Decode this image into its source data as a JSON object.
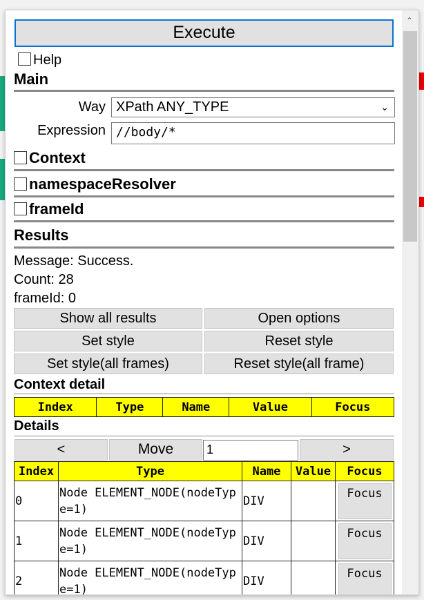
{
  "execute_label": "Execute",
  "help_label": "Help",
  "main": {
    "heading": "Main",
    "way_label": "Way",
    "way_value": "XPath ANY_TYPE",
    "expression_label": "Expression",
    "expression_value": "//body/*"
  },
  "sections": {
    "context": "Context",
    "namespace_resolver": "namespaceResolver",
    "frame_id": "frameId"
  },
  "results": {
    "heading": "Results",
    "message": "Message: Success.",
    "count": "Count: 28",
    "frame_id": "frameId: 0"
  },
  "buttons": {
    "show_all": "Show all results",
    "open_options": "Open options",
    "set_style": "Set style",
    "reset_style": "Reset style",
    "set_style_all": "Set style(all frames)",
    "reset_style_all": "Reset style(all frame)"
  },
  "context_detail": {
    "heading": "Context detail",
    "columns": [
      "Index",
      "Type",
      "Name",
      "Value",
      "Focus"
    ]
  },
  "details": {
    "heading": "Details",
    "prev": "<",
    "move": "Move",
    "move_value": "1",
    "next": ">",
    "columns": [
      "Index",
      "Type",
      "Name",
      "Value",
      "Focus"
    ],
    "rows": [
      {
        "index": "0",
        "type": "Node ELEMENT_NODE(nodeType=1)",
        "name": "DIV",
        "value": "",
        "focus": "Focus"
      },
      {
        "index": "1",
        "type": "Node ELEMENT_NODE(nodeType=1)",
        "name": "DIV",
        "value": "",
        "focus": "Focus"
      },
      {
        "index": "2",
        "type": "Node ELEMENT_NODE(nodeType=1)",
        "name": "DIV",
        "value": "",
        "focus": "Focus"
      }
    ]
  },
  "colors": {
    "header_yellow": "#ffff00",
    "accent_blue": "#0a72d0"
  }
}
